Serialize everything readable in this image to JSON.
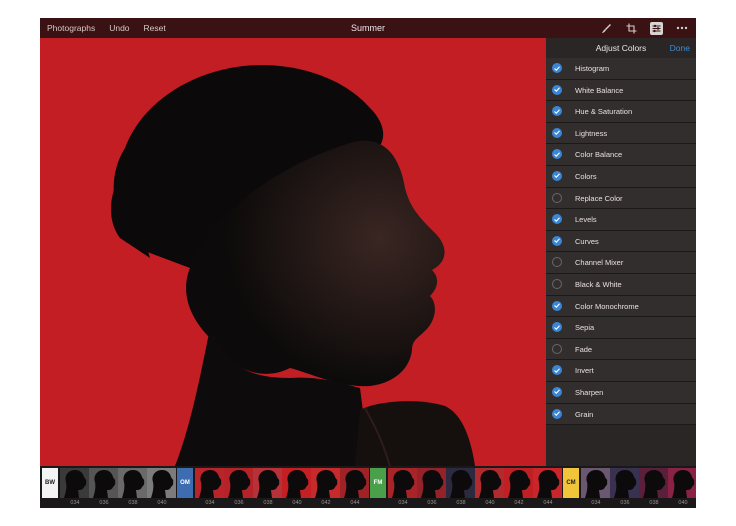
{
  "topbar": {
    "photographs_label": "Photographs",
    "undo_label": "Undo",
    "reset_label": "Reset",
    "title": "Summer",
    "icons": [
      "brush-icon",
      "crop-icon",
      "adjust-icon",
      "more-icon"
    ]
  },
  "panel": {
    "title": "Adjust Colors",
    "done_label": "Done",
    "items": [
      {
        "label": "Histogram",
        "checked": true
      },
      {
        "label": "White Balance",
        "checked": true
      },
      {
        "label": "Hue & Saturation",
        "checked": true
      },
      {
        "label": "Lightness",
        "checked": true
      },
      {
        "label": "Color Balance",
        "checked": true
      },
      {
        "label": "Colors",
        "checked": true
      },
      {
        "label": "Replace Color",
        "checked": false
      },
      {
        "label": "Levels",
        "checked": true
      },
      {
        "label": "Curves",
        "checked": true
      },
      {
        "label": "Channel Mixer",
        "checked": false
      },
      {
        "label": "Black & White",
        "checked": false
      },
      {
        "label": "Color Monochrome",
        "checked": true
      },
      {
        "label": "Sepia",
        "checked": true
      },
      {
        "label": "Fade",
        "checked": false
      },
      {
        "label": "Invert",
        "checked": true
      },
      {
        "label": "Sharpen",
        "checked": true
      },
      {
        "label": "Grain",
        "checked": true
      }
    ]
  },
  "presets": {
    "groups": [
      {
        "tag": "BW",
        "tag_color": "#f4f4f4",
        "tag_text_color": "#222222",
        "numbers": [
          "034",
          "036",
          "038",
          "040"
        ],
        "bg_colors": [
          "#3a3a3a",
          "#555555",
          "#6a6a6a",
          "#7c7c7c"
        ]
      },
      {
        "tag": "OM",
        "tag_color": "#3d6cb0",
        "tag_text_color": "#ffffff",
        "numbers": [
          "034",
          "036",
          "038",
          "040",
          "042",
          "044"
        ],
        "bg_colors": [
          "#b8242a",
          "#b52328",
          "#b73238",
          "#c42024",
          "#c52a2c",
          "#9e2226"
        ]
      },
      {
        "tag": "FM",
        "tag_color": "#4a9f4a",
        "tag_text_color": "#ffffff",
        "numbers": [
          "034",
          "036",
          "038",
          "040",
          "042",
          "044"
        ],
        "bg_colors": [
          "#a82428",
          "#952228",
          "#2c2a40",
          "#b02a2e",
          "#c01f24",
          "#c8262a"
        ]
      },
      {
        "tag": "CM",
        "tag_color": "#f1c53a",
        "tag_text_color": "#222222",
        "numbers": [
          "034",
          "036",
          "038",
          "040"
        ],
        "bg_colors": [
          "#6a5870",
          "#3a3050",
          "#5a1f3a",
          "#8a2246"
        ]
      }
    ]
  }
}
